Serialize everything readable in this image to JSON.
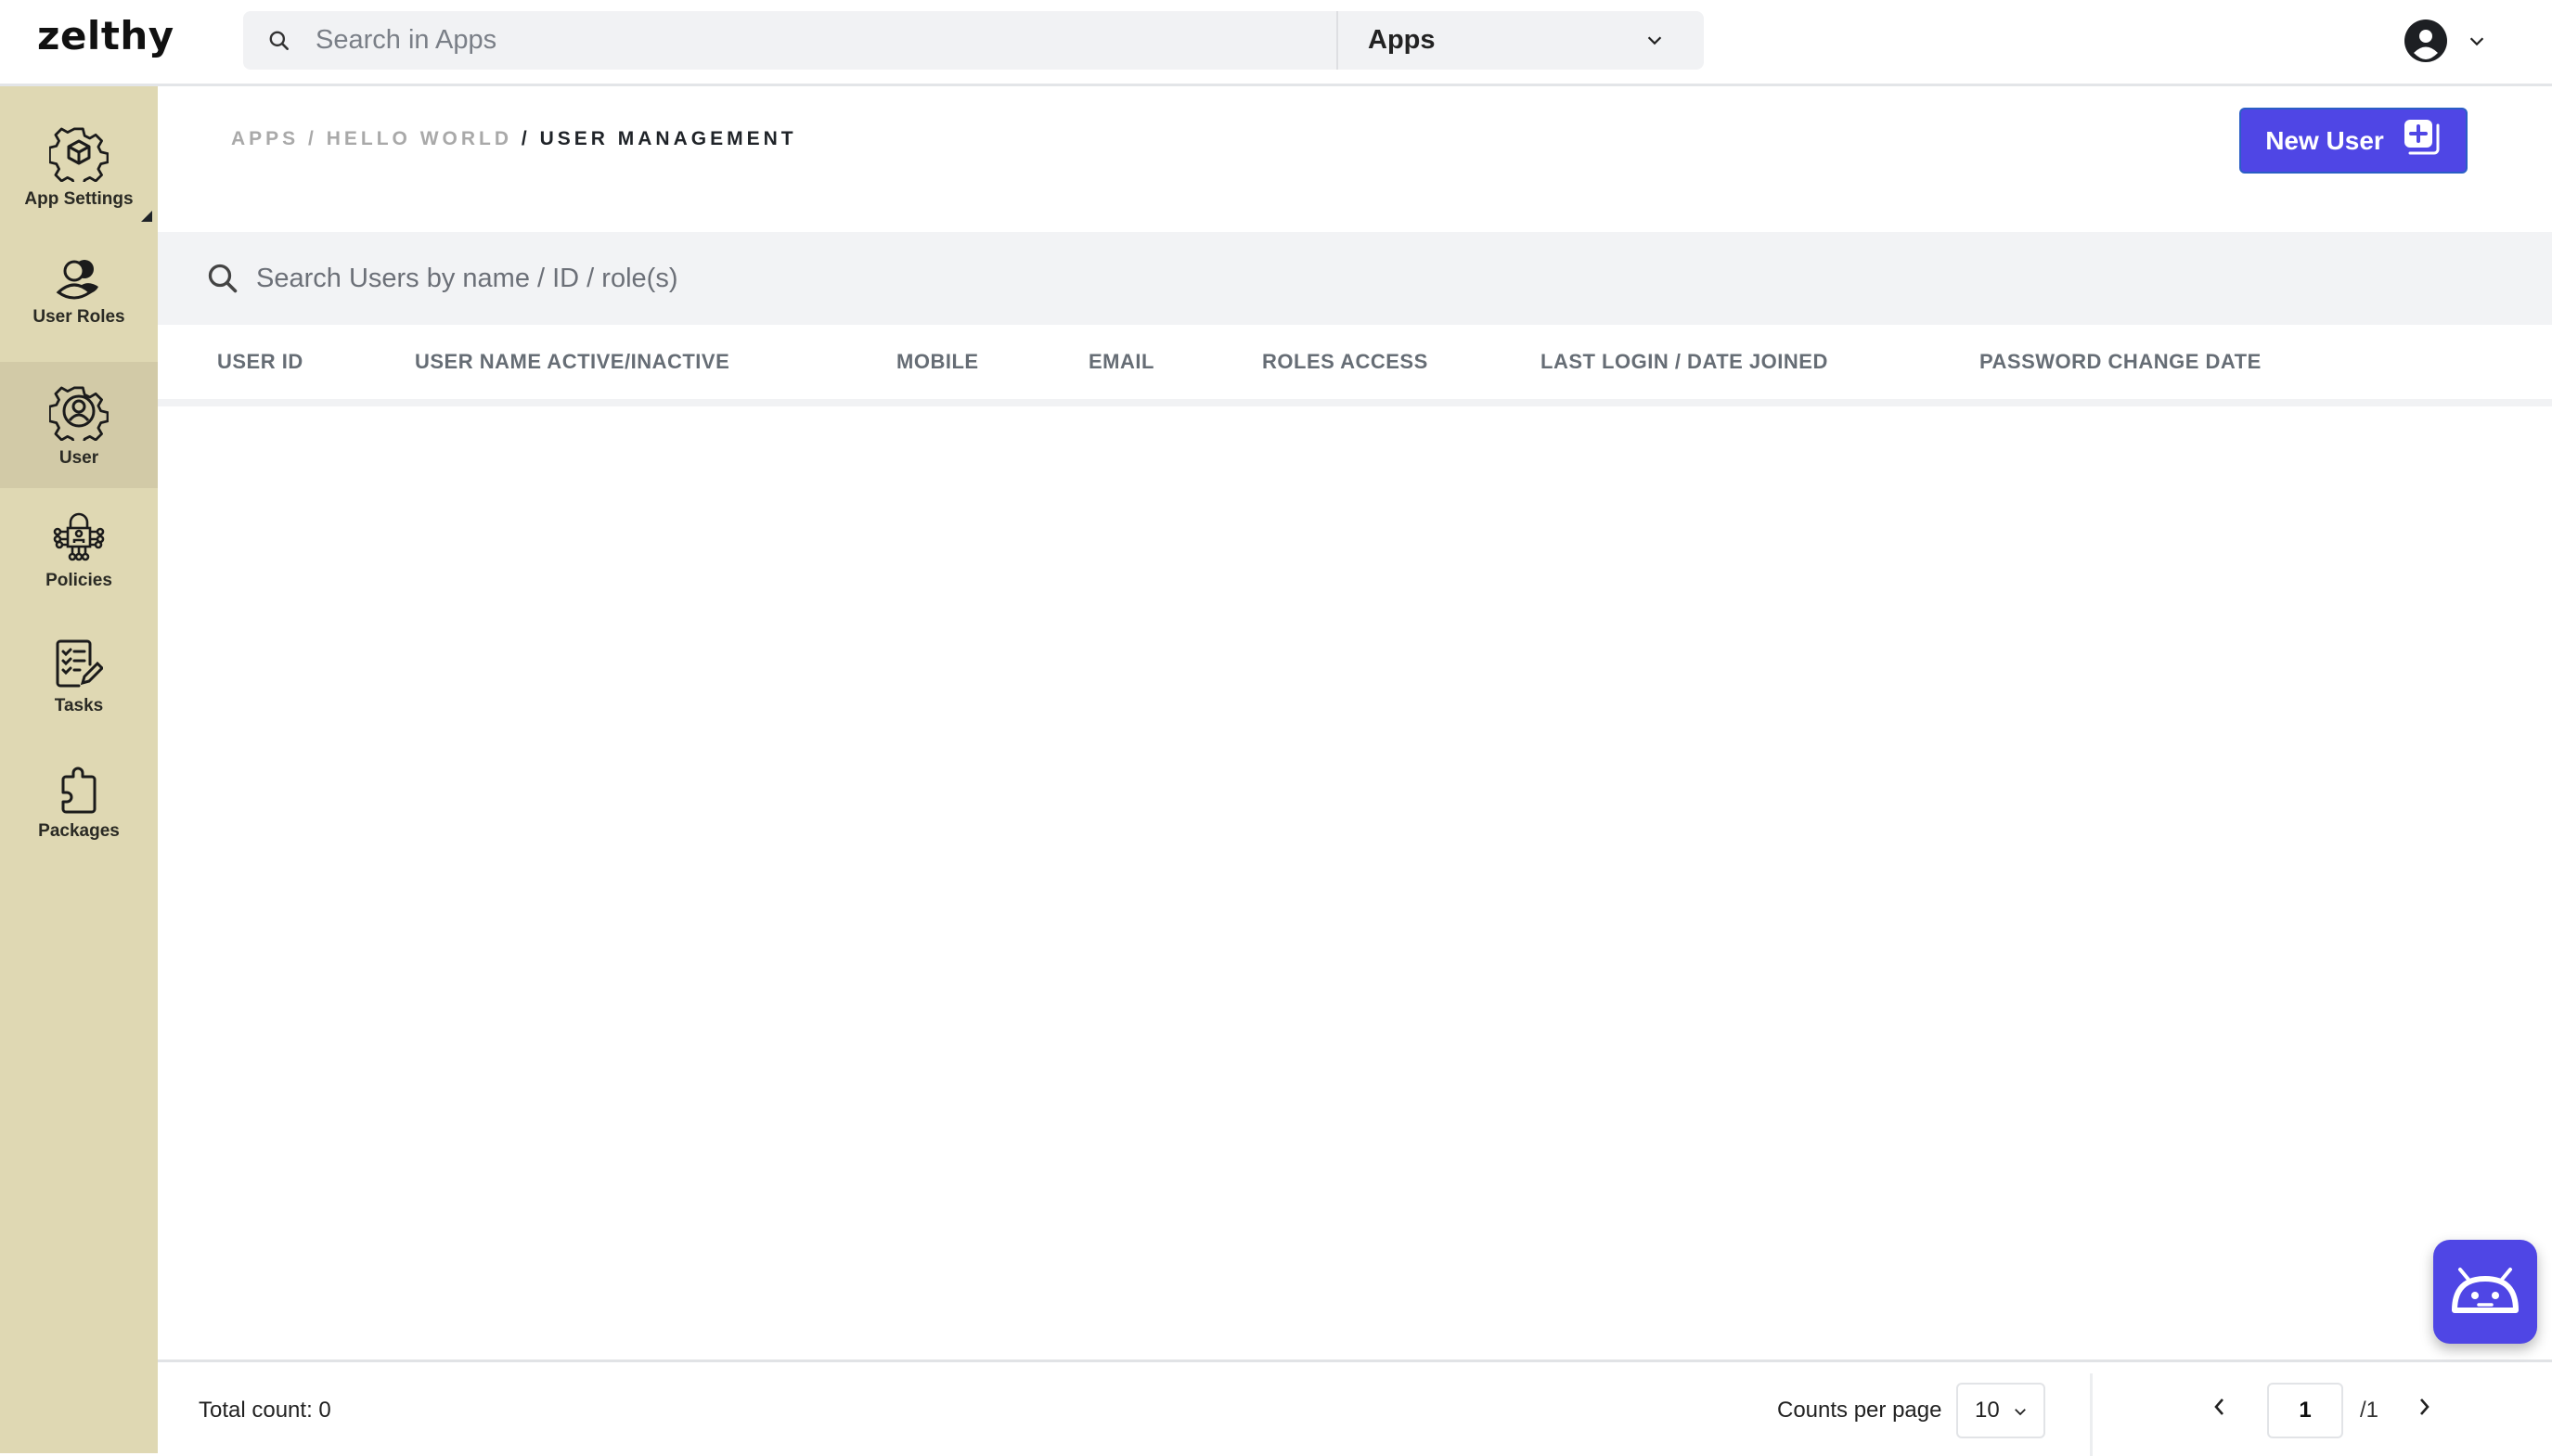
{
  "topbar": {
    "logo": "zelthy",
    "search_placeholder": "Search in Apps",
    "search_value": "",
    "apps_select_value": "Apps",
    "profile_icon": "user-circle-icon"
  },
  "sidebar": {
    "items": [
      {
        "label": "App Settings",
        "icon": "gear-cube-icon",
        "active": false
      },
      {
        "label": "User Roles",
        "icon": "users-icon",
        "active": false
      },
      {
        "label": "User",
        "icon": "gear-user-icon",
        "active": true
      },
      {
        "label": "Policies",
        "icon": "lock-circuit-icon",
        "active": false
      },
      {
        "label": "Tasks",
        "icon": "checklist-pencil-icon",
        "active": false
      },
      {
        "label": "Packages",
        "icon": "puzzle-icon",
        "active": false
      }
    ]
  },
  "breadcrumb": {
    "items": [
      "APPS",
      "HELLO WORLD",
      "USER MANAGEMENT"
    ],
    "separator": "/"
  },
  "new_user_button": {
    "label": "New User",
    "icon": "add-square-icon"
  },
  "user_search": {
    "placeholder": "Search Users by name / ID / role(s)",
    "value": ""
  },
  "table": {
    "columns": [
      "USER ID",
      "USER NAME ACTIVE/INACTIVE",
      "MOBILE",
      "EMAIL",
      "ROLES ACCESS",
      "LAST LOGIN / DATE JOINED",
      "PASSWORD CHANGE DATE"
    ],
    "rows": []
  },
  "footer": {
    "total_count_label": "Total count: 0",
    "counts_per_page_label": "Counts per page",
    "counts_per_page_value": "10",
    "current_page": "1",
    "total_pages_label": "/1"
  },
  "colors": {
    "accent": "#4f46e5",
    "sidebar_bg": "#dfd8b3",
    "sidebar_active": "#d2caa7"
  },
  "bot_fab": {
    "icon": "android-bot-icon"
  }
}
